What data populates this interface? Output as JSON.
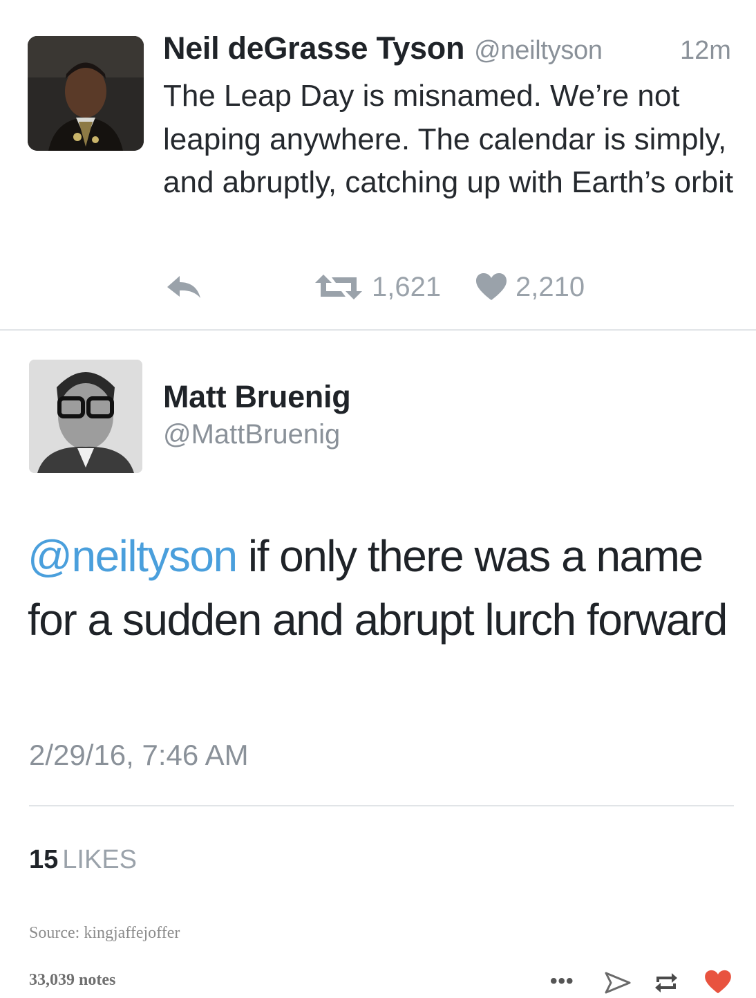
{
  "tweet1": {
    "name": "Neil deGrasse Tyson",
    "handle": "@neiltyson",
    "time": "12m",
    "text": "The Leap Day is misnamed. We’re not leaping anywhere. The calendar is simply, and abruptly, catching up with Earth’s orbit",
    "retweets": "1,621",
    "likes": "2,210"
  },
  "tweet2": {
    "name": "Matt Bruenig",
    "handle": "@MattBruenig",
    "mention": "@neiltyson",
    "text": " if only there was a name for a sudden and abrupt lurch forward",
    "date": "2/29/16, 7:46 AM",
    "likes_count": "15",
    "likes_label": "LIKES"
  },
  "post": {
    "source": "Source: kingjaffejoffer",
    "notes": "33,039 notes",
    "more": "•••"
  },
  "colors": {
    "mention": "#4a9fdc",
    "secondary_text": "#8a9199",
    "heart": "#e8533f"
  },
  "icons": [
    "reply-icon",
    "retweet-icon",
    "heart-icon",
    "share-icon",
    "reblog-icon",
    "like-heart-icon"
  ]
}
